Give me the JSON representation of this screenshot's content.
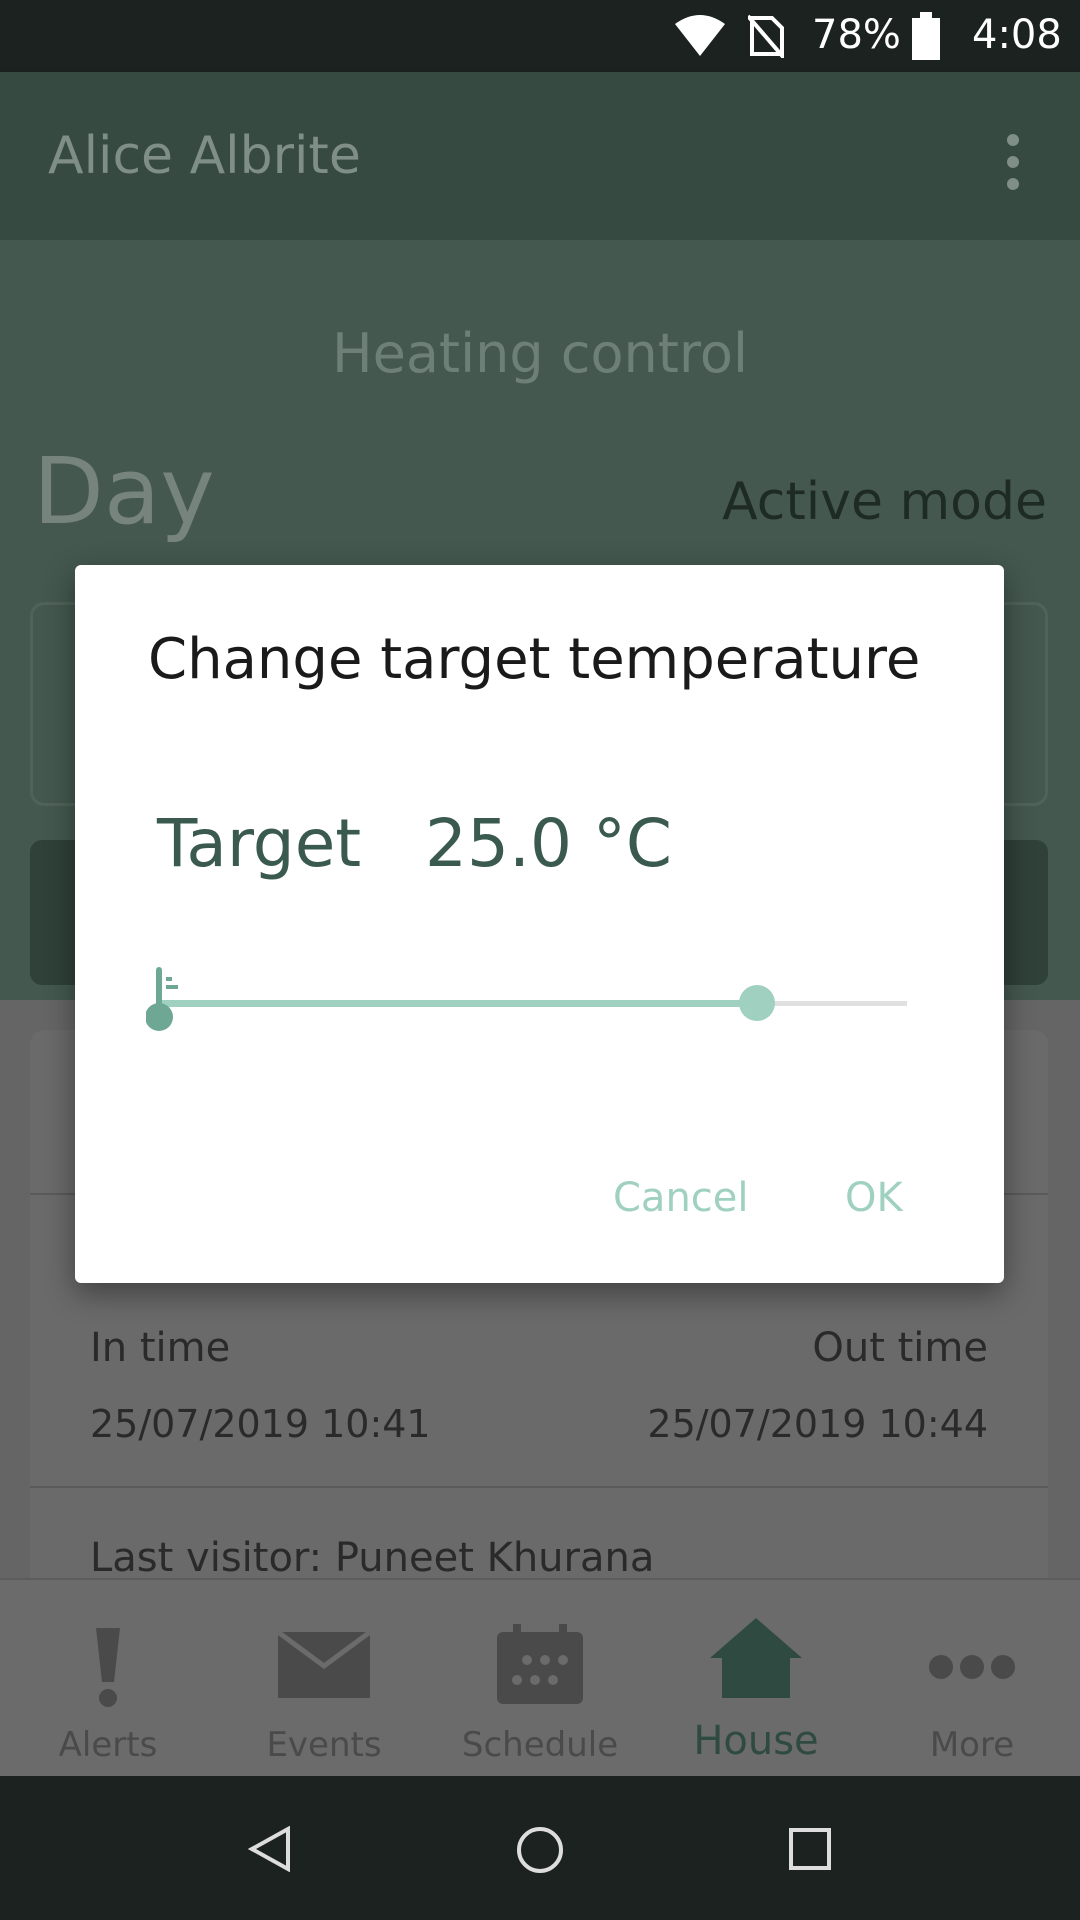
{
  "status_bar": {
    "battery": "78%",
    "time": "4:08"
  },
  "app_bar": {
    "title": "Alice Albrite"
  },
  "hero": {
    "title": "Heating control",
    "mode_name": "Day",
    "mode_status": "Active mode"
  },
  "visit": {
    "in_label": "In time",
    "in_value": "25/07/2019 10:41",
    "out_label": "Out time",
    "out_value": "25/07/2019 10:44",
    "last_visitor": "Last visitor: Puneet Khurana"
  },
  "bottom_nav": {
    "items": [
      {
        "label": "Alerts",
        "icon": "exclamation-icon"
      },
      {
        "label": "Events",
        "icon": "envelope-icon"
      },
      {
        "label": "Schedule",
        "icon": "calendar-icon"
      },
      {
        "label": "House",
        "icon": "house-icon",
        "active": true
      },
      {
        "label": "More",
        "icon": "more-dots-icon"
      }
    ]
  },
  "dialog": {
    "title": "Change target temperature",
    "target_label": "Target",
    "target_value": "25.0 °C",
    "slider_fraction": 0.8,
    "cancel": "Cancel",
    "ok": "OK"
  },
  "colors": {
    "accent": "#9fd0c0",
    "primary_dark": "#364a42",
    "text_green": "#3a5a50"
  }
}
